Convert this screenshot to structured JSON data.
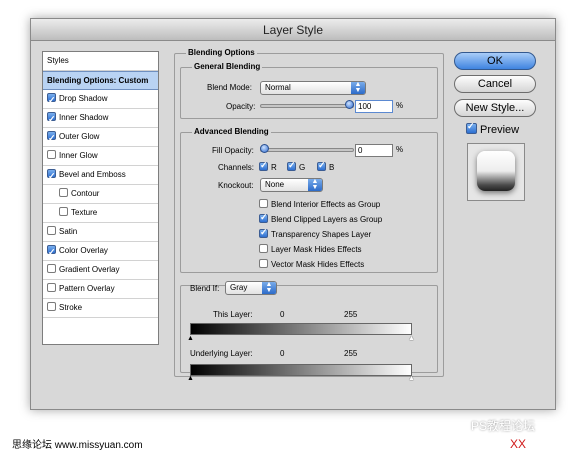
{
  "window": {
    "title": "Layer Style"
  },
  "styles_list": [
    {
      "label": "Styles",
      "checkbox": null,
      "selected": false,
      "heading": true
    },
    {
      "label": "Blending Options: Custom",
      "checkbox": null,
      "selected": true
    },
    {
      "label": "Drop Shadow",
      "checkbox": true
    },
    {
      "label": "Inner Shadow",
      "checkbox": true
    },
    {
      "label": "Outer Glow",
      "checkbox": true
    },
    {
      "label": "Inner Glow",
      "checkbox": false
    },
    {
      "label": "Bevel and Emboss",
      "checkbox": true
    },
    {
      "label": "Contour",
      "checkbox": false,
      "indent": true
    },
    {
      "label": "Texture",
      "checkbox": false,
      "indent": true
    },
    {
      "label": "Satin",
      "checkbox": false
    },
    {
      "label": "Color Overlay",
      "checkbox": true
    },
    {
      "label": "Gradient Overlay",
      "checkbox": false
    },
    {
      "label": "Pattern Overlay",
      "checkbox": false
    },
    {
      "label": "Stroke",
      "checkbox": false
    }
  ],
  "blending": {
    "section_title": "Blending Options",
    "general": {
      "title": "General Blending",
      "blend_mode_label": "Blend Mode:",
      "blend_mode_value": "Normal",
      "opacity_label": "Opacity:",
      "opacity_value": "100",
      "opacity_fraction": 1.0,
      "percent": "%"
    },
    "advanced": {
      "title": "Advanced Blending",
      "fill_opacity_label": "Fill Opacity:",
      "fill_opacity_value": "0",
      "fill_opacity_fraction": 0.0,
      "percent": "%",
      "channels_label": "Channels:",
      "channels": [
        {
          "label": "R",
          "on": true
        },
        {
          "label": "G",
          "on": true
        },
        {
          "label": "B",
          "on": true
        }
      ],
      "knockout_label": "Knockout:",
      "knockout_value": "None",
      "options": [
        {
          "label": "Blend Interior Effects as Group",
          "on": false
        },
        {
          "label": "Blend Clipped Layers as Group",
          "on": true
        },
        {
          "label": "Transparency Shapes Layer",
          "on": true
        },
        {
          "label": "Layer Mask Hides Effects",
          "on": false
        },
        {
          "label": "Vector Mask Hides Effects",
          "on": false
        }
      ]
    },
    "blend_if": {
      "label": "Blend If:",
      "value": "Gray",
      "this_layer": {
        "label": "This Layer:",
        "low": "0",
        "high": "255"
      },
      "underlying": {
        "label": "Underlying Layer:",
        "low": "0",
        "high": "255"
      }
    }
  },
  "buttons": {
    "ok": "OK",
    "cancel": "Cancel",
    "new_style": "New Style...",
    "preview_label": "Preview",
    "preview_on": true
  },
  "watermark": {
    "left": "思缘论坛  www.missyuan.com",
    "right": "PS教程论坛",
    "right2": "XX"
  },
  "colors": {
    "accent": "#3f84e0",
    "selected_row": "#b9d3f3",
    "watermark_red": "#d01818"
  }
}
